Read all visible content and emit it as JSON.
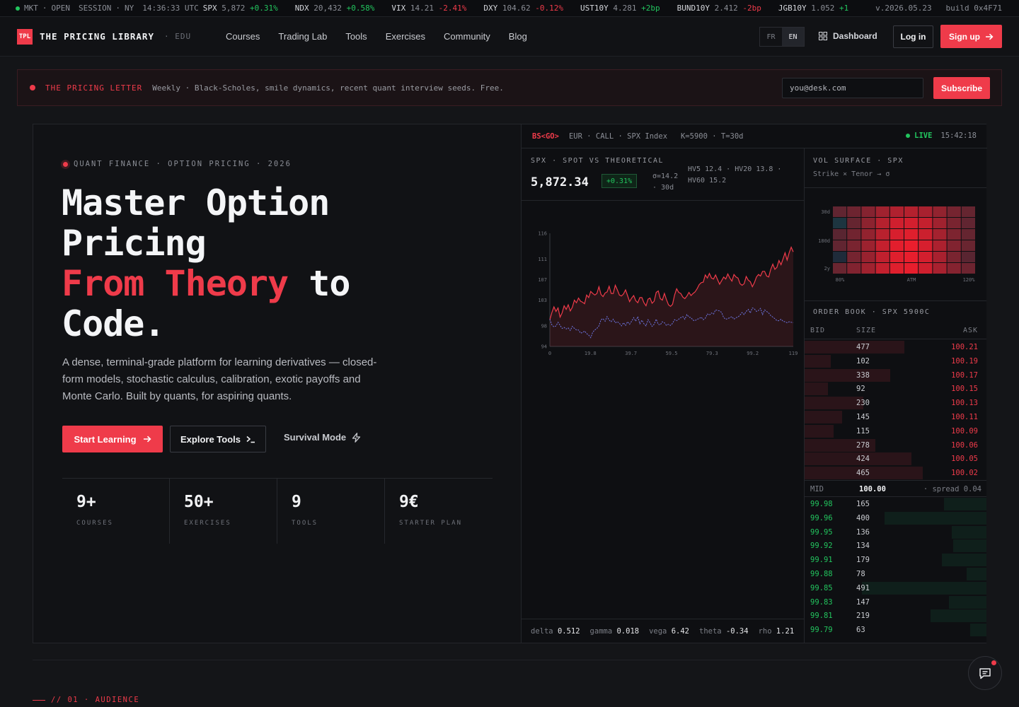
{
  "ticker": {
    "mkt": "MKT",
    "open": "OPEN",
    "session": "SESSION",
    "city": "NY",
    "time": "14:36:33 UTC",
    "items": [
      {
        "sym": "SPX",
        "val": "5,872",
        "chg": "+0.31%",
        "dir": "up"
      },
      {
        "sym": "NDX",
        "val": "20,432",
        "chg": "+0.58%",
        "dir": "up"
      },
      {
        "sym": "VIX",
        "val": "14.21",
        "chg": "-2.41%",
        "dir": "dn"
      },
      {
        "sym": "DXY",
        "val": "104.62",
        "chg": "-0.12%",
        "dir": "dn"
      },
      {
        "sym": "UST10Y",
        "val": "4.281",
        "chg": "+2bp",
        "dir": "up"
      },
      {
        "sym": "BUND10Y",
        "val": "2.412",
        "chg": "-2bp",
        "dir": "dn"
      },
      {
        "sym": "JGB10Y",
        "val": "1.052",
        "chg": "+1",
        "dir": "up"
      }
    ],
    "version": "v.2026.05.23",
    "build": "build 0x4F71"
  },
  "nav": {
    "logo_mark": "TPL",
    "logo": "THE PRICING LIBRARY",
    "edu": "· EDU",
    "links": [
      "Courses",
      "Trading Lab",
      "Tools",
      "Exercises",
      "Community",
      "Blog"
    ],
    "lang": [
      "FR",
      "EN"
    ],
    "dashboard": "Dashboard",
    "login": "Log in",
    "signup": "Sign up"
  },
  "banner": {
    "title": "THE PRICING LETTER",
    "text": "Weekly · Black-Scholes, smile dynamics, recent quant interview seeds. Free.",
    "email_value": "you@desk.com",
    "subscribe": "Subscribe"
  },
  "hero": {
    "eyebrow": "QUANT FINANCE · OPTION PRICING · 2026",
    "h1_line1": "Master Option",
    "h1_line2": "Pricing",
    "h1_red": "From Theory",
    "h1_to": " to",
    "h1_line4": "Code.",
    "lead": "A dense, terminal-grade platform for learning derivatives — closed-form models, stochastic calculus, calibration, exotic payoffs and Monte Carlo. Built by quants, for aspiring quants.",
    "start": "Start Learning",
    "explore": "Explore Tools",
    "survival": "Survival Mode",
    "stats": [
      {
        "value": "9+",
        "label": "COURSES"
      },
      {
        "value": "50+",
        "label": "EXERCISES"
      },
      {
        "value": "9",
        "label": "TOOLS"
      },
      {
        "value": "9€",
        "label": "STARTER PLAN"
      }
    ]
  },
  "terminal": {
    "cmd": "BS<GO>",
    "info": "EUR · CALL · SPX Index   K=5900 · T=30d",
    "live": "LIVE",
    "clock": "15:42:18",
    "panel_title": "SPX · SPOT VS THEORETICAL",
    "price": "5,872.34",
    "change": "+0.31%",
    "sigma": "σ=14.2 · 30d",
    "hv": "HV5 12.4 · HV20 13.8 · HV60 15.2",
    "greeks": [
      {
        "name": "delta",
        "value": "0.512"
      },
      {
        "name": "gamma",
        "value": "0.018"
      },
      {
        "name": "vega",
        "value": "6.42"
      },
      {
        "name": "theta",
        "value": "-0.34"
      },
      {
        "name": "rho",
        "value": "1.21"
      }
    ],
    "vol_title": "VOL SURFACE · SPX",
    "vol_sub": "Strike × Tenor → σ",
    "vol_rows": [
      "30d",
      "180d",
      "2y"
    ],
    "vol_cols": [
      "80%",
      "ATM",
      "120%"
    ],
    "book_title": "ORDER BOOK · SPX 5900C",
    "book_headers": [
      "BID",
      "SIZE",
      "ASK"
    ],
    "asks": [
      {
        "size": "477",
        "price": "100.21",
        "depth": 0.8
      },
      {
        "size": "102",
        "price": "100.19",
        "depth": 0.21
      },
      {
        "size": "338",
        "price": "100.17",
        "depth": 0.69
      },
      {
        "size": "92",
        "price": "100.15",
        "depth": 0.19
      },
      {
        "size": "230",
        "price": "100.13",
        "depth": 0.47
      },
      {
        "size": "145",
        "price": "100.11",
        "depth": 0.3
      },
      {
        "size": "115",
        "price": "100.09",
        "depth": 0.23
      },
      {
        "size": "278",
        "price": "100.06",
        "depth": 0.57
      },
      {
        "size": "424",
        "price": "100.05",
        "depth": 0.86
      },
      {
        "size": "465",
        "price": "100.02",
        "depth": 0.95
      }
    ],
    "mid_label": "MID",
    "mid": "100.00",
    "spread": "· spread 0.04",
    "bids": [
      {
        "price": "99.98",
        "size": "165",
        "depth": 0.34
      },
      {
        "price": "99.96",
        "size": "400",
        "depth": 0.82
      },
      {
        "price": "99.95",
        "size": "136",
        "depth": 0.28
      },
      {
        "price": "99.92",
        "size": "134",
        "depth": 0.27
      },
      {
        "price": "99.91",
        "size": "179",
        "depth": 0.36
      },
      {
        "price": "99.88",
        "size": "78",
        "depth": 0.16
      },
      {
        "price": "99.85",
        "size": "491",
        "depth": 1.0
      },
      {
        "price": "99.83",
        "size": "147",
        "depth": 0.3
      },
      {
        "price": "99.81",
        "size": "219",
        "depth": 0.45
      },
      {
        "price": "99.79",
        "size": "63",
        "depth": 0.13
      }
    ]
  },
  "chart_data": {
    "type": "line",
    "ylim": [
      94,
      116
    ],
    "xlim": [
      0,
      119
    ],
    "y_ticks": [
      94,
      98,
      103,
      107,
      111,
      116
    ],
    "x_ticks": [
      "0",
      "19.8",
      "39.7",
      "59.5",
      "79.3",
      "99.2",
      "119"
    ],
    "series": [
      {
        "color": "#ef3b4a",
        "values": [
          99.2,
          100.6,
          101.7,
          100.8,
          101.5,
          99.7,
          100.5,
          101.9,
          101.2,
          102.1,
          100.9,
          101.6,
          103.0,
          102.5,
          103.4,
          102.8,
          102.6,
          102.3,
          104.0,
          103.5,
          104.7,
          104.3,
          104.0,
          104.3,
          105.6,
          104.1,
          103.7,
          104.4,
          104.6,
          105.7,
          104.3,
          104.3,
          105.9,
          105.0,
          104.0,
          103.8,
          104.2,
          105.0,
          103.9,
          102.7,
          103.4,
          103.9,
          102.9,
          102.5,
          103.5,
          103.5,
          102.5,
          101.9,
          103.2,
          103.4,
          102.4,
          102.8,
          104.5,
          104.8,
          103.3,
          103.0,
          104.3,
          103.1,
          102.1,
          101.8,
          102.2,
          104.0,
          105.2,
          104.5,
          104.3,
          103.6,
          103.3,
          103.8,
          104.5,
          103.9,
          104.3,
          104.6,
          105.2,
          106.0,
          106.4,
          106.5,
          107.9,
          107.3,
          108.2,
          107.3,
          107.1,
          107.9,
          107.0,
          106.1,
          106.8,
          107.5,
          107.1,
          108.1,
          107.3,
          106.7,
          108.0,
          107.5,
          107.3,
          106.2,
          105.9,
          106.2,
          107.6,
          106.9,
          106.6,
          105.6,
          106.4,
          107.5,
          108.0,
          107.7,
          108.6,
          108.6,
          107.7,
          107.5,
          109.0,
          110.0,
          109.0,
          109.4,
          110.7,
          109.9,
          111.0,
          112.2,
          110.8,
          112.2,
          113.3,
          112.4
        ]
      },
      {
        "color": "#6f78e8",
        "values": [
          99.3,
          98.2,
          97.8,
          98.0,
          98.7,
          98.1,
          97.5,
          97.7,
          97.4,
          97.6,
          97.1,
          97.9,
          97.5,
          97.2,
          97.2,
          96.6,
          96.7,
          97.0,
          96.5,
          96.2,
          95.7,
          96.8,
          97.2,
          97.5,
          98.0,
          99.2,
          99.4,
          98.9,
          99.8,
          99.1,
          98.8,
          99.3,
          98.6,
          98.8,
          98.5,
          98.0,
          98.6,
          98.1,
          98.8,
          98.3,
          98.9,
          99.6,
          98.9,
          99.8,
          98.4,
          99.1,
          98.4,
          98.0,
          99.2,
          98.6,
          97.9,
          98.3,
          99.3,
          98.3,
          98.2,
          98.8,
          98.6,
          98.1,
          98.3,
          98.1,
          98.5,
          99.2,
          99.0,
          99.3,
          99.6,
          99.8,
          99.3,
          100.2,
          99.7,
          99.6,
          99.1,
          99.0,
          99.3,
          99.4,
          99.7,
          99.2,
          99.5,
          100.3,
          100.1,
          100.5,
          100.3,
          101.1,
          101.0,
          100.9,
          100.6,
          99.6,
          99.3,
          99.4,
          99.6,
          99.8,
          99.3,
          99.6,
          99.7,
          100.1,
          100.6,
          100.2,
          100.8,
          101.2,
          100.5,
          101.5,
          101.3,
          100.8,
          101.0,
          101.4,
          100.2,
          101.1,
          100.8,
          100.5,
          100.0,
          99.7,
          99.4,
          99.0,
          99.0,
          99.3,
          98.9,
          98.8,
          98.6,
          98.8,
          98.7,
          98.6
        ]
      }
    ]
  },
  "vol_surface": {
    "rows": 6,
    "cols": 10,
    "values": [
      [
        0.3,
        0.36,
        0.48,
        0.62,
        0.7,
        0.72,
        0.66,
        0.55,
        0.4,
        0.32
      ],
      [
        0.18,
        0.32,
        0.52,
        0.72,
        0.86,
        0.88,
        0.8,
        0.62,
        0.42,
        0.3
      ],
      [
        0.26,
        0.38,
        0.55,
        0.74,
        0.9,
        0.94,
        0.84,
        0.64,
        0.44,
        0.32
      ],
      [
        0.3,
        0.42,
        0.6,
        0.8,
        0.96,
        1.0,
        0.9,
        0.68,
        0.46,
        0.34
      ],
      [
        0.22,
        0.4,
        0.58,
        0.78,
        0.94,
        0.98,
        0.88,
        0.66,
        0.42,
        0.26
      ],
      [
        0.34,
        0.46,
        0.62,
        0.8,
        0.94,
        0.98,
        0.86,
        0.66,
        0.48,
        0.36
      ]
    ]
  },
  "footer": {
    "section": "// 01 · AUDIENCE"
  }
}
